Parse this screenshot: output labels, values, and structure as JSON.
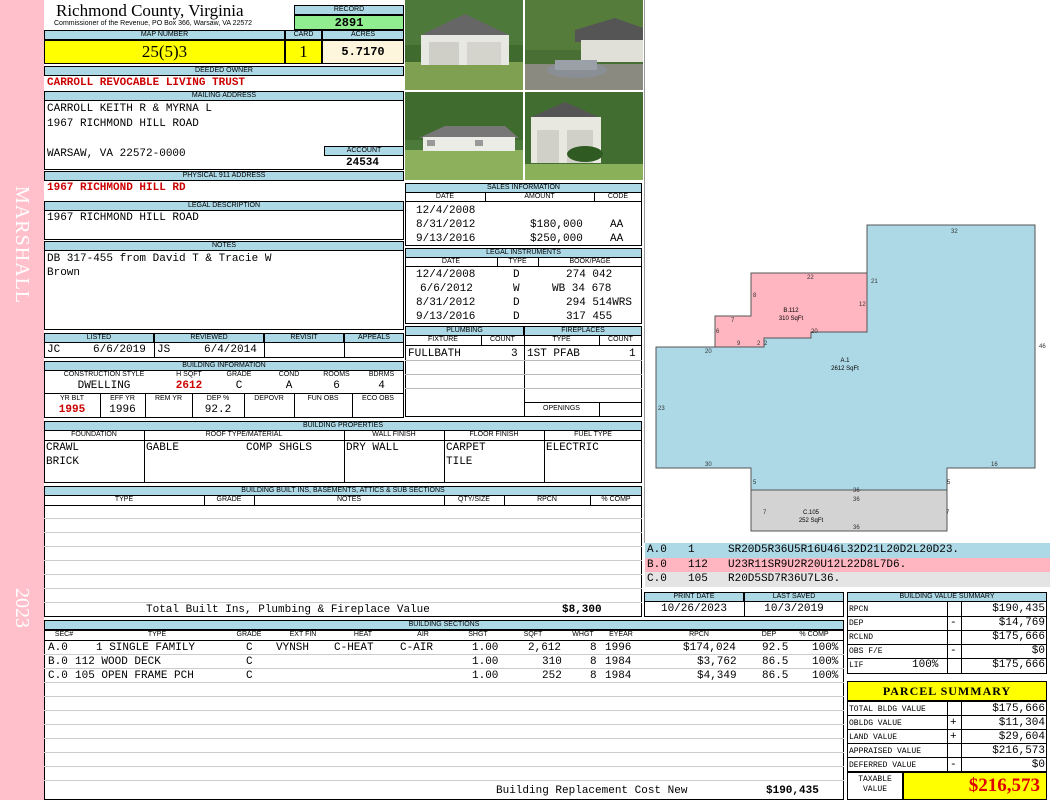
{
  "side": {
    "district": "MARSHALL",
    "year": "2023"
  },
  "header": {
    "county": "Richmond County, Virginia",
    "commissioner": "Commissioner of the Revenue, PO Box 366, Warsaw, VA 22572",
    "record_label": "RECORD",
    "record": "2891",
    "map_label": "MAP NUMBER",
    "map": "25(5)3",
    "card_label": "CARD",
    "card": "1",
    "acres_label": "ACRES",
    "acres": "5.7170"
  },
  "owner": {
    "label": "DEEDED OWNER",
    "name": "CARROLL REVOCABLE LIVING TRUST",
    "mail_label": "MAILING ADDRESS",
    "mail1": "CARROLL KEITH R & MYRNA L",
    "mail2": "1967 RICHMOND HILL ROAD",
    "mail3": "WARSAW, VA 22572-0000",
    "account_label": "ACCOUNT",
    "account": "24534",
    "phys_label": "PHYSICAL 911 ADDRESS",
    "phys": "1967 RICHMOND HILL RD",
    "legal_label": "LEGAL DESCRIPTION",
    "legal": "1967 RICHMOND HILL ROAD",
    "notes_label": "NOTES",
    "notes1": "DB 317-455 from David T & Tracie W",
    "notes2": "Brown"
  },
  "listing": {
    "listed_label": "LISTED",
    "reviewed_label": "REVIEWED",
    "revisit_label": "REVISIT",
    "appeals_label": "APPEALS",
    "listed_by": "JC",
    "listed_date": "6/6/2019",
    "reviewed_by": "JS",
    "reviewed_date": "6/4/2014"
  },
  "building_info": {
    "label": "BUILDING INFORMATION",
    "h": [
      "CONSTRUCTION STYLE",
      "H SQFT",
      "GRADE",
      "COND",
      "ROOMS",
      "BDRMS"
    ],
    "v": [
      "DWELLING",
      "2612",
      "C",
      "A",
      "6",
      "4"
    ],
    "h2": [
      "YR BLT",
      "EFF YR",
      "REM YR",
      "DEP %",
      "DEPOVR",
      "FUN OBS",
      "ECO OBS"
    ],
    "v2": [
      "1995",
      "1996",
      "",
      "92.2",
      "",
      "",
      ""
    ]
  },
  "properties": {
    "label": "BUILDING PROPERTIES",
    "h": [
      "FOUNDATION",
      "ROOF TYPE/MATERIAL",
      "WALL FINISH",
      "FLOOR FINISH",
      "FUEL TYPE"
    ],
    "foundation1": "CRAWL",
    "foundation2": "BRICK",
    "roof_type": "GABLE",
    "roof_mat": "COMP SHGLS",
    "wall": "DRY WALL",
    "floor1": "CARPET",
    "floor2": "TILE",
    "fuel": "ELECTRIC"
  },
  "builtins": {
    "label": "BUILDING BUILT INS, BASEMENTS, ATTICS & SUB SECTIONS",
    "h": [
      "TYPE",
      "GRADE",
      "NOTES",
      "QTY/SIZE",
      "RPCN",
      "% COMP"
    ],
    "total_label": "Total Built Ins, Plumbing & Fireplace Value",
    "total": "$8,300"
  },
  "sales": {
    "label": "SALES INFORMATION",
    "h": [
      "DATE",
      "AMOUNT",
      "CODE"
    ],
    "rows": [
      [
        "12/4/2008",
        "",
        ""
      ],
      [
        "8/31/2012",
        "$180,000",
        "AA"
      ],
      [
        "9/13/2016",
        "$250,000",
        "AA"
      ]
    ]
  },
  "instruments": {
    "label": "LEGAL INSTRUMENTS",
    "h": [
      "DATE",
      "TYPE",
      "BOOK/PAGE"
    ],
    "rows": [
      [
        "12/4/2008",
        "D",
        "274 042"
      ],
      [
        "6/6/2012",
        "W",
        "WB 34 678"
      ],
      [
        "8/31/2012",
        "D",
        "294 514WRS"
      ],
      [
        "9/13/2016",
        "D",
        "317 455"
      ]
    ]
  },
  "plumbing": {
    "label": "PLUMBING",
    "h": [
      "FIXTURE",
      "COUNT"
    ],
    "fixture": "FULLBATH",
    "count": "3"
  },
  "fireplaces": {
    "label": "FIREPLACES",
    "h": [
      "TYPE",
      "COUNT"
    ],
    "type": "1ST PFAB",
    "count": "1",
    "openings": "OPENINGS"
  },
  "sketch": {
    "labels": {
      "a": "A.1",
      "a_sq": "2612 SqFt",
      "b": "B.112",
      "b_sq": "310 SqFt",
      "c": "C.105",
      "c_sq": "252 SqFt"
    },
    "colors": {
      "a": "#add8e6",
      "b": "#ffb6c1",
      "c": "#d3d3d3"
    },
    "dims": [
      "32",
      "46",
      "21",
      "22",
      "12",
      "8",
      "7",
      "6",
      "9",
      "2",
      "2",
      "20",
      "20",
      "23",
      "30",
      "16",
      "5",
      "5",
      "36",
      "36",
      "7",
      "7",
      "36"
    ],
    "legend": [
      [
        "A.0",
        "1",
        "SR20D5R36U5R16U46L32D21L20D2L20D23."
      ],
      [
        "B.0",
        "112",
        "U23R11SR9U2R20U12L22D8L7D6."
      ],
      [
        "C.0",
        "105",
        "R20D5SD7R36U7L36."
      ]
    ]
  },
  "dates": {
    "print_label": "PRINT DATE",
    "print": "10/26/2023",
    "saved_label": "LAST SAVED",
    "saved": "10/3/2019"
  },
  "sections": {
    "label": "BUILDING SECTIONS",
    "h": [
      "SEC#",
      "TYPE",
      "GRADE",
      "EXT FIN",
      "HEAT",
      "AIR",
      "SHGT",
      "SQFT",
      "WHGT",
      "EYEAR",
      "RPCN",
      "DEP",
      "% COMP"
    ],
    "rows": [
      [
        "A.0",
        "1 SINGLE FAMILY",
        "C",
        "VYNSH",
        "C-HEAT",
        "C-AIR",
        "1.00",
        "2,612",
        "8",
        "1996",
        "$174,024",
        "92.5",
        "100%"
      ],
      [
        "B.0",
        "112 WOOD DECK",
        "C",
        "",
        "",
        "",
        "1.00",
        "310",
        "8",
        "1984",
        "$3,762",
        "86.5",
        "100%"
      ],
      [
        "C.0",
        "105 OPEN FRAME PCH",
        "C",
        "",
        "",
        "",
        "1.00",
        "252",
        "8",
        "1984",
        "$4,349",
        "86.5",
        "100%"
      ]
    ],
    "rcn_label": "Building Replacement Cost New",
    "rcn": "$190,435"
  },
  "value_summary": {
    "label": "BUILDING VALUE SUMMARY",
    "rows": [
      [
        "RPCN",
        "",
        "$190,435"
      ],
      [
        "DEP",
        "-",
        "$14,769"
      ],
      [
        "RCLND",
        "",
        "$175,666"
      ],
      [
        "OBS F/E",
        "-",
        "$0"
      ],
      [
        "LIF",
        "100%",
        "$175,666"
      ]
    ]
  },
  "parcel": {
    "label": "PARCEL SUMMARY",
    "rows": [
      [
        "TOTAL BLDG VALUE",
        "",
        "$175,666"
      ],
      [
        "OBLDG VALUE",
        "+",
        "$11,304"
      ],
      [
        "LAND VALUE",
        "+",
        "$29,604"
      ],
      [
        "APPRAISED VALUE",
        "",
        "$216,573"
      ],
      [
        "DEFERRED VALUE",
        "-",
        "$0"
      ]
    ],
    "taxable_label1": "TAXABLE",
    "taxable_label2": "VALUE",
    "taxable": "$216,573"
  }
}
